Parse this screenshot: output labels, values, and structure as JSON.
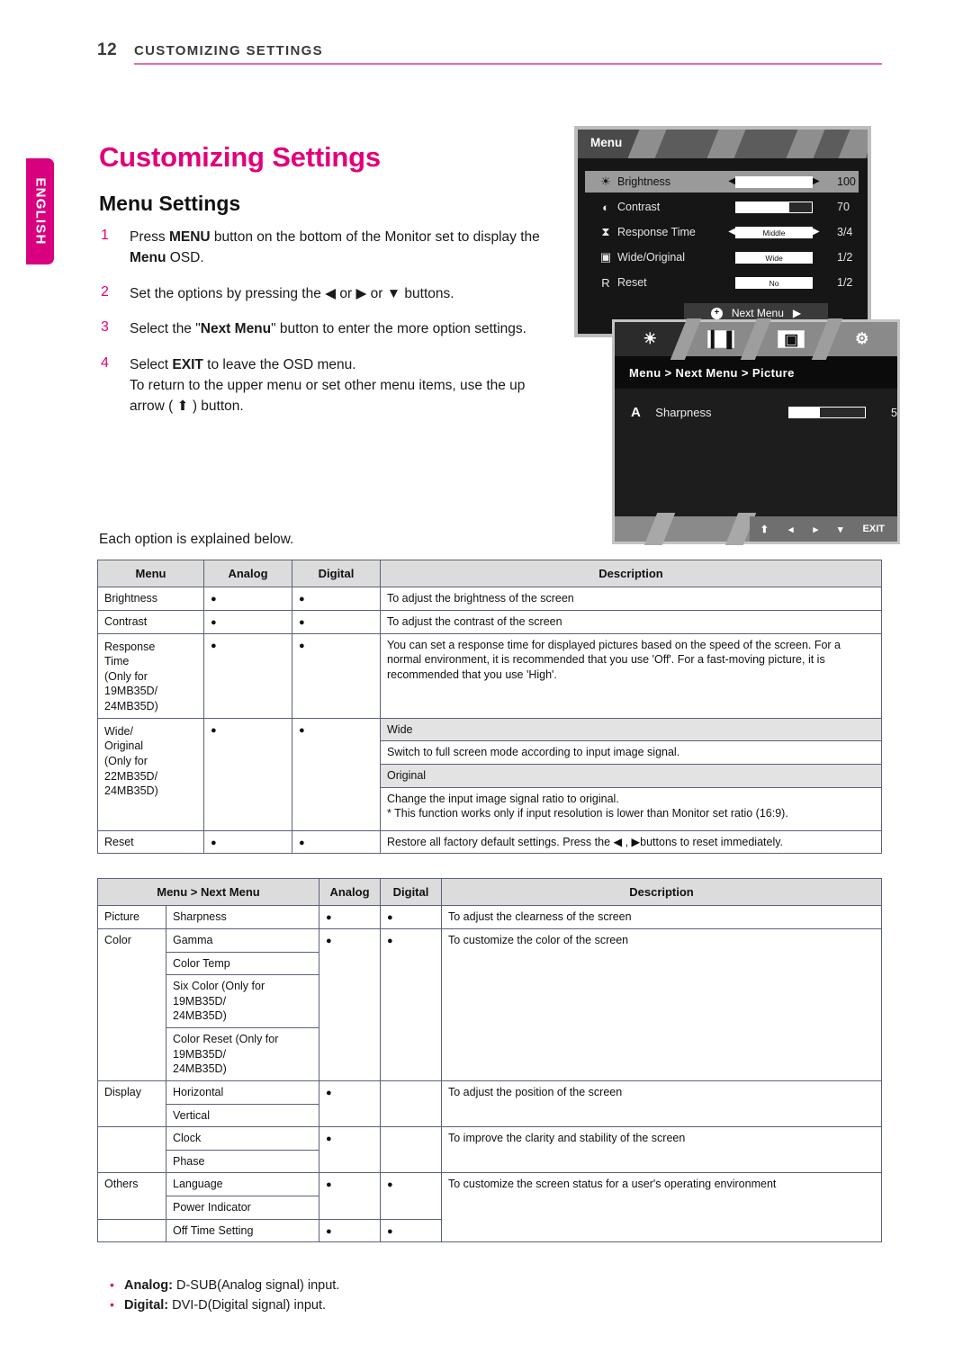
{
  "header": {
    "page_number": "12",
    "chapter": "CUSTOMIZING SETTINGS",
    "rule_color": "#ec6aad"
  },
  "sidebar": {
    "language_tab": "ENGLISH",
    "tab_color": "#d8007f"
  },
  "titles": {
    "main": "Customizing Settings",
    "main_color": "#e2007a",
    "sub": "Menu Settings"
  },
  "steps": [
    {
      "num": "1",
      "html": "Press <b>MENU</b> button on the bottom of the Monitor set to display the <b>Menu</b> OSD."
    },
    {
      "num": "2",
      "html": "Set the options by pressing the ◀ or ▶ or ▼ buttons."
    },
    {
      "num": "3",
      "html": "Select the \"<b>Next Menu</b>\" button to enter the more option settings."
    },
    {
      "num": "4",
      "html": "Select <b>EXIT</b> to leave the OSD menu.<br>To return to the upper menu or set other menu items, use the up arrow ( ⬆ ) button."
    }
  ],
  "each_option_note": "Each option is explained below.",
  "osd_main": {
    "title": "Menu",
    "rows": [
      {
        "icon": "brightness-icon",
        "glyph": "☀",
        "name": "Brightness",
        "control": "slider-arrows",
        "fill_percent": 100,
        "value": "100",
        "selected": true
      },
      {
        "icon": "contrast-icon",
        "glyph": "◐",
        "name": "Contrast",
        "control": "slider",
        "fill_percent": 70,
        "value": "70",
        "selected": false
      },
      {
        "icon": "response-time-icon",
        "glyph": "⧗",
        "name": "Response Time",
        "control": "pill-arrows",
        "pill_text": "Middle",
        "value": "3/4",
        "selected": false
      },
      {
        "icon": "wide-original-icon",
        "glyph": "▣",
        "name": "Wide/Original",
        "control": "pill",
        "pill_text": "Wide",
        "value": "1/2",
        "selected": false
      },
      {
        "icon": "reset-icon",
        "glyph": "R",
        "name": "Reset",
        "control": "pill",
        "pill_text": "No",
        "value": "1/2",
        "selected": false
      }
    ],
    "next_menu_label": "Next Menu",
    "next_menu_plus": "+",
    "next_menu_arrow": "▶"
  },
  "osd_picture": {
    "tabs": [
      {
        "name": "picture-tab-icon",
        "glyph": "☀",
        "active": true
      },
      {
        "name": "color-tab-icon",
        "glyph": "▎▐",
        "active": false
      },
      {
        "name": "display-tab-icon",
        "glyph": "▣",
        "active": false
      },
      {
        "name": "others-tab-icon",
        "glyph": "⚙",
        "active": false
      }
    ],
    "breadcrumb": "Menu  >  Next Menu  >  Picture",
    "row": {
      "icon": "sharpness-icon",
      "glyph": "A",
      "name": "Sharpness",
      "fill_percent": 40,
      "value": "5"
    },
    "footer_buttons": [
      "⬆",
      "◂",
      "▸",
      "▾",
      "EXIT"
    ]
  },
  "table_1": {
    "headers": [
      "Menu",
      "Analog",
      "Digital",
      "Description"
    ],
    "rows": [
      {
        "menu": "Brightness",
        "analog": "●",
        "digital": "●",
        "description": "To adjust the brightness of the screen"
      },
      {
        "menu": "Contrast",
        "analog": "●",
        "digital": "●",
        "description": "To adjust the contrast of the screen"
      },
      {
        "menu": "Response Time\n(Only for 19MB35D/\n24MB35D)",
        "menu_lines": [
          "Response",
          "Time",
          "(Only for",
          "19MB35D/",
          "24MB35D)"
        ],
        "analog": "●",
        "digital": "●",
        "description": "You can set a response time for displayed pictures based on the speed of the screen. For a normal environment, it is recommended that you use 'Off'. For a fast-moving picture, it is recommended that you use 'High'."
      },
      {
        "menu_lines": [
          "Wide/",
          "Original",
          "(Only for",
          "22MB35D/",
          "24MB35D)"
        ],
        "analog": "●",
        "digital": "●",
        "sub_blocks": [
          {
            "title": "Wide",
            "text": "Switch to full screen mode according to input image signal."
          },
          {
            "title": "Original",
            "text": "Change the input image signal ratio to original.\n* This function works only if input resolution is lower than Monitor set ratio (16:9)."
          }
        ]
      },
      {
        "menu": "Reset",
        "analog": "●",
        "digital": "●",
        "description": "Restore all factory default settings. Press the ◀ , ▶buttons to reset immediately."
      }
    ],
    "wide_block": {
      "wide_title": "Wide",
      "wide_text": "Switch to full screen mode according to input image signal.",
      "original_title": "Original",
      "original_text_1": "Change the input image signal ratio to original.",
      "original_text_2": "* This function works only if input resolution is lower than Monitor set ratio (16:9)."
    }
  },
  "table_2": {
    "headers": [
      "Menu > Next Menu",
      "Analog",
      "Digital",
      "Description"
    ],
    "groups": [
      {
        "group": "Picture",
        "items": [
          "Sharpness"
        ],
        "analog": "●",
        "digital": "●",
        "description": "To adjust the clearness of the screen"
      },
      {
        "group": "Color",
        "items": [
          "Gamma",
          "Color Temp",
          "Six Color (Only for 19MB35D/ 24MB35D)",
          "Color Reset (Only for 19MB35D/ 24MB35D)"
        ],
        "item_lines": [
          [
            "Gamma"
          ],
          [
            "Color Temp"
          ],
          [
            "Six Color (Only for",
            "19MB35D/",
            "24MB35D)"
          ],
          [
            "Color Reset (Only for",
            "19MB35D/",
            "24MB35D)"
          ]
        ],
        "analog": "●",
        "digital": "●",
        "description": "To customize the color of the screen"
      },
      {
        "group": "Display",
        "items": [
          "Horizontal",
          "Vertical"
        ],
        "analog": "●",
        "digital": "",
        "description": "To adjust the position of the screen"
      },
      {
        "group": "",
        "items": [
          "Clock",
          "Phase"
        ],
        "analog": "●",
        "digital": "",
        "description": "To improve the clarity and stability of the screen"
      },
      {
        "group": "Others",
        "items": [
          "Language",
          "Power Indicator"
        ],
        "analog": "●",
        "digital": "●",
        "description": "To customize the screen status for a user's operating environment"
      },
      {
        "group": "",
        "items": [
          "Off Time Setting"
        ],
        "analog": "●",
        "digital": "●",
        "description": ""
      }
    ]
  },
  "footnotes": [
    {
      "label": "Analog:",
      "text": " D-SUB(Analog signal) input."
    },
    {
      "label": "Digital:",
      "text": " DVI-D(Digital signal) input."
    }
  ]
}
